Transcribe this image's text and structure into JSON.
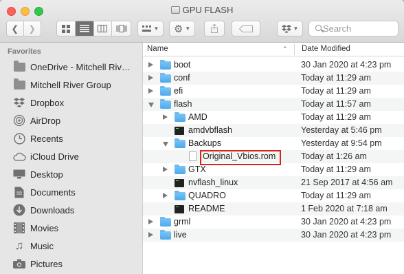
{
  "window": {
    "title": "GPU FLASH"
  },
  "toolbar": {
    "nav": [
      "back",
      "forward"
    ],
    "view_modes": [
      "icon-view",
      "list-view",
      "column-view",
      "cover-flow-view"
    ],
    "active_view": "list-view",
    "arrange": "group-icon",
    "action": "gear-icon",
    "share": "share-icon",
    "tag": "tag-icon",
    "dropbox": "dropbox-icon"
  },
  "search": {
    "placeholder": "Search"
  },
  "sidebar": {
    "header": "Favorites",
    "items": [
      {
        "label": "OneDrive - Mitchell River Group",
        "icon": "folder-icon"
      },
      {
        "label": "Mitchell River Group",
        "icon": "folder-icon"
      },
      {
        "label": "Dropbox",
        "icon": "dropbox-icon"
      },
      {
        "label": "AirDrop",
        "icon": "airdrop-icon"
      },
      {
        "label": "Recents",
        "icon": "clock-icon"
      },
      {
        "label": "iCloud Drive",
        "icon": "cloud-icon"
      },
      {
        "label": "Desktop",
        "icon": "desktop-icon"
      },
      {
        "label": "Documents",
        "icon": "document-icon"
      },
      {
        "label": "Downloads",
        "icon": "download-icon"
      },
      {
        "label": "Movies",
        "icon": "film-icon"
      },
      {
        "label": "Music",
        "icon": "music-icon"
      },
      {
        "label": "Pictures",
        "icon": "camera-icon"
      }
    ]
  },
  "columns": {
    "name": "Name",
    "date": "Date Modified"
  },
  "files": [
    {
      "name": "boot",
      "date": "30 Jan 2020 at 4:23 pm",
      "kind": "folder",
      "level": 0,
      "disclosure": "closed"
    },
    {
      "name": "conf",
      "date": "Today at 11:29 am",
      "kind": "folder",
      "level": 0,
      "disclosure": "closed"
    },
    {
      "name": "efi",
      "date": "Today at 11:29 am",
      "kind": "folder",
      "level": 0,
      "disclosure": "closed"
    },
    {
      "name": "flash",
      "date": "Today at 11:57 am",
      "kind": "folder",
      "level": 0,
      "disclosure": "open"
    },
    {
      "name": "AMD",
      "date": "Today at 11:29 am",
      "kind": "folder",
      "level": 1,
      "disclosure": "closed"
    },
    {
      "name": "amdvbflash",
      "date": "Yesterday at 5:46 pm",
      "kind": "exec",
      "level": 1,
      "disclosure": "none"
    },
    {
      "name": "Backups",
      "date": "Yesterday at 9:54 pm",
      "kind": "folder",
      "level": 1,
      "disclosure": "open"
    },
    {
      "name": "Original_Vbios.rom",
      "date": "Today at 1:26 am",
      "kind": "doc",
      "level": 2,
      "disclosure": "none"
    },
    {
      "name": "GTX",
      "date": "Today at 11:29 am",
      "kind": "folder",
      "level": 1,
      "disclosure": "closed"
    },
    {
      "name": "nvflash_linux",
      "date": "21 Sep 2017 at 4:56 am",
      "kind": "exec",
      "level": 1,
      "disclosure": "none"
    },
    {
      "name": "QUADRO",
      "date": "Today at 11:29 am",
      "kind": "folder",
      "level": 1,
      "disclosure": "closed"
    },
    {
      "name": "README",
      "date": "1 Feb 2020 at 7:18 am",
      "kind": "exec",
      "level": 1,
      "disclosure": "none"
    },
    {
      "name": "grml",
      "date": "30 Jan 2020 at 4:23 pm",
      "kind": "folder",
      "level": 0,
      "disclosure": "closed"
    },
    {
      "name": "live",
      "date": "30 Jan 2020 at 4:23 pm",
      "kind": "folder",
      "level": 0,
      "disclosure": "closed"
    }
  ],
  "annotation": {
    "highlighted_file": "Original_Vbios.rom",
    "color": "#d9211d"
  }
}
